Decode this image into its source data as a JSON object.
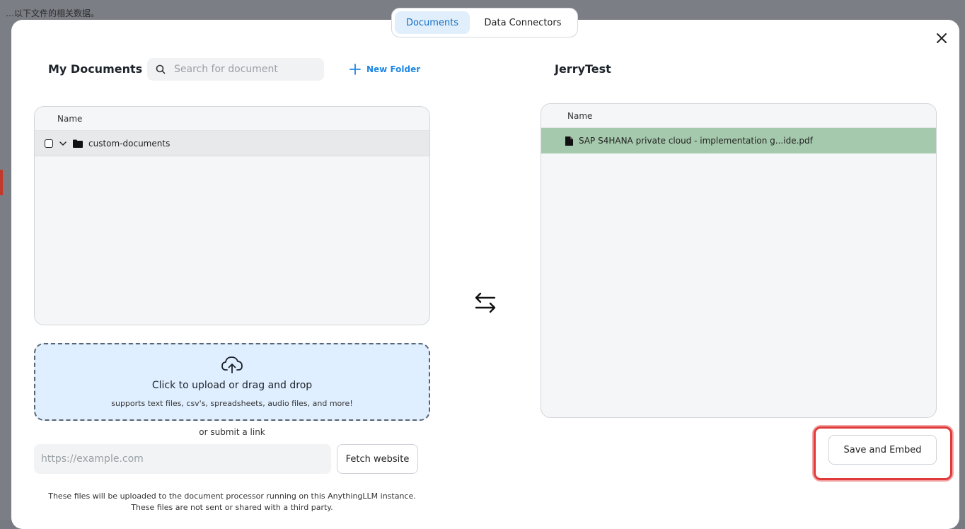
{
  "backdrop": {
    "text": "…以下文件的相关数据。"
  },
  "tabs": [
    {
      "label": "Documents",
      "active": true
    },
    {
      "label": "Data Connectors",
      "active": false
    }
  ],
  "left": {
    "title": "My Documents",
    "search_placeholder": "Search for document",
    "new_folder_label": "New Folder",
    "column_header": "Name",
    "rows": [
      {
        "name": "custom-documents",
        "type": "folder",
        "checked": false,
        "expanded": true
      }
    ]
  },
  "right": {
    "title": "JerryTest",
    "column_header": "Name",
    "rows": [
      {
        "name": "SAP S4HANA private cloud - implementation g...ide.pdf",
        "type": "file",
        "selected": true
      }
    ]
  },
  "upload": {
    "title": "Click to upload or drag and drop",
    "subtitle": "supports text files, csv's, spreadsheets, audio files, and more!",
    "or_link_label": "or submit a link",
    "url_placeholder": "https://example.com",
    "fetch_button": "Fetch website",
    "footnote_line1": "These files will be uploaded to the document processor running on this AnythingLLM instance.",
    "footnote_line2": "These files are not sent or shared with a third party."
  },
  "actions": {
    "save_embed_label": "Save and Embed"
  },
  "colors": {
    "accent": "#1e88e5",
    "active_tab_bg": "#e1eefb",
    "selected_row": "#a5c9ac",
    "upload_bg": "#e0efff",
    "highlight": "#e03a3a"
  }
}
